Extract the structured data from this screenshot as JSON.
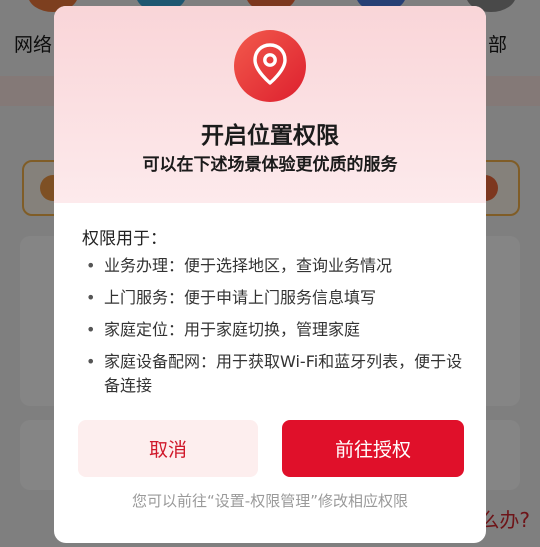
{
  "background": {
    "left_label": "网络",
    "right_label": "部",
    "bottom_right_text": "么办?"
  },
  "dialog": {
    "icon": "location-pin-icon",
    "title": "开启位置权限",
    "subtitle": "可以在下述场景体验更优质的服务",
    "usage_heading": "权限用于：",
    "usage_items": [
      "业务办理：便于选择地区，查询业务情况",
      "上门服务：便于申请上门服务信息填写",
      "家庭定位：用于家庭切换，管理家庭",
      "家庭设备配网：用于获取Wi-Fi和蓝牙列表，便于设备连接"
    ],
    "cancel_label": "取消",
    "authorize_label": "前往授权",
    "footer_note": "您可以前往“设置-权限管理”修改相应权限"
  },
  "colors": {
    "accent": "#e0102a",
    "header_pink": "#f9d5d8",
    "cancel_bg": "#fdeeee"
  }
}
